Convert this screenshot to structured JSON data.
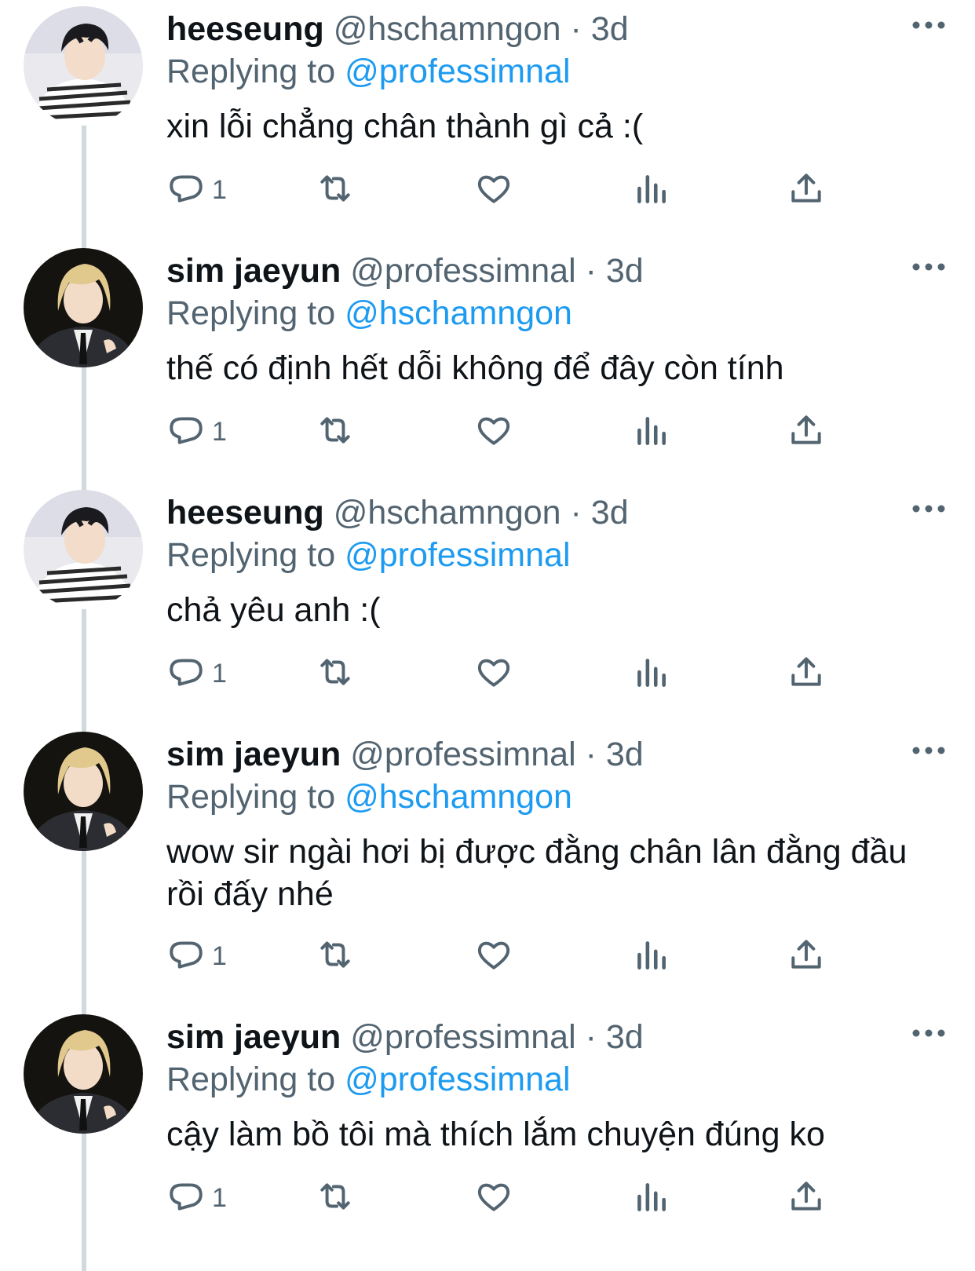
{
  "replies": [
    {
      "avatar": "heeseung-avatar",
      "name": "heeseung",
      "handle": "@hschamngon",
      "separator": "·",
      "time": "3d",
      "replying_label": "Replying to",
      "replying_to": "@professimnal",
      "text": "xin lỗi chẳng chân thành gì cả :(",
      "reply_count": "1"
    },
    {
      "avatar": "jaeyun-avatar",
      "name": "sim jaeyun",
      "handle": "@professimnal",
      "separator": "·",
      "time": "3d",
      "replying_label": "Replying to",
      "replying_to": "@hschamngon",
      "text": "thế có định hết dỗi không để đây còn tính",
      "reply_count": "1"
    },
    {
      "avatar": "heeseung-avatar",
      "name": "heeseung",
      "handle": "@hschamngon",
      "separator": "·",
      "time": "3d",
      "replying_label": "Replying to",
      "replying_to": "@professimnal",
      "text": "chả yêu anh :(",
      "reply_count": "1"
    },
    {
      "avatar": "jaeyun-avatar",
      "name": "sim jaeyun",
      "handle": "@professimnal",
      "separator": "·",
      "time": "3d",
      "replying_label": "Replying to",
      "replying_to": "@hschamngon",
      "text": "wow sir ngài hơi bị được đằng chân lân đằng đầu rồi đấy nhé",
      "reply_count": "1"
    },
    {
      "avatar": "jaeyun-avatar",
      "name": "sim jaeyun",
      "handle": "@professimnal",
      "separator": "·",
      "time": "3d",
      "replying_label": "Replying to",
      "replying_to": "@professimnal",
      "text": "cậy làm bồ tôi mà thích lắm chuyện đúng ko",
      "reply_count": "1"
    }
  ],
  "colors": {
    "text": "#0f1419",
    "secondary": "#536471",
    "link": "#1d9bf0",
    "thread_line": "#cfd9de"
  },
  "icons": [
    "reply-icon",
    "retweet-icon",
    "like-icon",
    "views-icon",
    "share-icon",
    "more-icon"
  ]
}
